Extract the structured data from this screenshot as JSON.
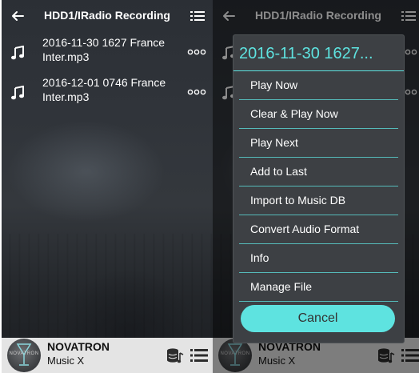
{
  "left": {
    "title": "HDD1/IRadio Recording",
    "files": [
      {
        "line1": "2016-11-30 1627 France",
        "line2": "Inter.mp3"
      },
      {
        "line1": "2016-12-01 0746 France",
        "line2": "Inter.mp3"
      }
    ],
    "player": {
      "brand": "NOVATRON",
      "subtitle": "Music X",
      "logo_text": "NOVATRON"
    }
  },
  "right": {
    "title": "HDD1/IRadio Recording",
    "player": {
      "brand": "NOVATRON",
      "subtitle": "Music X",
      "logo_text": "NOVATRON"
    },
    "dialog": {
      "title": "2016-11-30 1627...",
      "items": [
        "Play Now",
        "Clear & Play Now",
        "Play Next",
        "Add to Last",
        "Import to Music DB",
        "Convert Audio Format",
        "Info",
        "Manage File"
      ],
      "cancel_label": "Cancel"
    }
  },
  "colors": {
    "accent": "#5ee3e0",
    "dialog_bg": "#3d4044",
    "bottom_bar": "#e4e4e4"
  },
  "icons": [
    "back-arrow-icon",
    "list-menu-icon",
    "music-note-icon",
    "more-options-icon",
    "database-music-icon",
    "playlist-icon"
  ]
}
